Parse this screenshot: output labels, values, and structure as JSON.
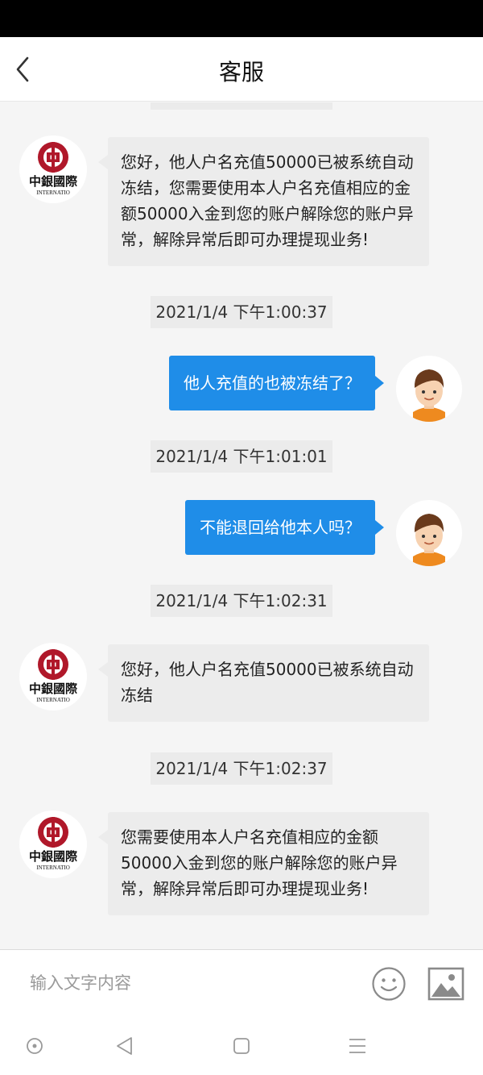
{
  "header": {
    "title": "客服"
  },
  "messages": [
    {
      "from": "agent",
      "text": "您好，他人户名充值50000已被系统自动冻结，您需要使用本人户名充值相应的金额50000入金到您的账户解除您的账户异常，解除异常后即可办理提现业务!"
    },
    {
      "time": "2021/1/4 下午1:00:37"
    },
    {
      "from": "user",
      "text": "他人充值的也被冻结了？"
    },
    {
      "time": "2021/1/4 下午1:01:01"
    },
    {
      "from": "user",
      "text": "不能退回给他本人吗？"
    },
    {
      "time": "2021/1/4 下午1:02:31"
    },
    {
      "from": "agent",
      "text": "您好，他人户名充值50000已被系统自动冻结"
    },
    {
      "time": "2021/1/4 下午1:02:37"
    },
    {
      "from": "agent",
      "text": "您需要使用本人户名充值相应的金额50000入金到您的账户解除您的账户异常，解除异常后即可办理提现业务!"
    }
  ],
  "bank_logo": {
    "name_chars": "中銀國際",
    "subtext": "INTERNATIO"
  },
  "input": {
    "placeholder": "输入文字内容",
    "value": ""
  },
  "icons": {
    "back": "chevron-left-icon",
    "emoji": "smiley-icon",
    "image": "image-icon",
    "agent_avatar": "bank-logo",
    "user_avatar": "boy-avatar-icon",
    "system_nav": [
      "circle-icon",
      "triangle-back-icon",
      "square-home-icon",
      "menu-lines-icon"
    ]
  },
  "colors": {
    "outgoing_bubble": "#1f8de8",
    "incoming_bubble": "#ececec",
    "timestamp_bg": "#ebebeb",
    "brand_red": "#b0182a"
  }
}
